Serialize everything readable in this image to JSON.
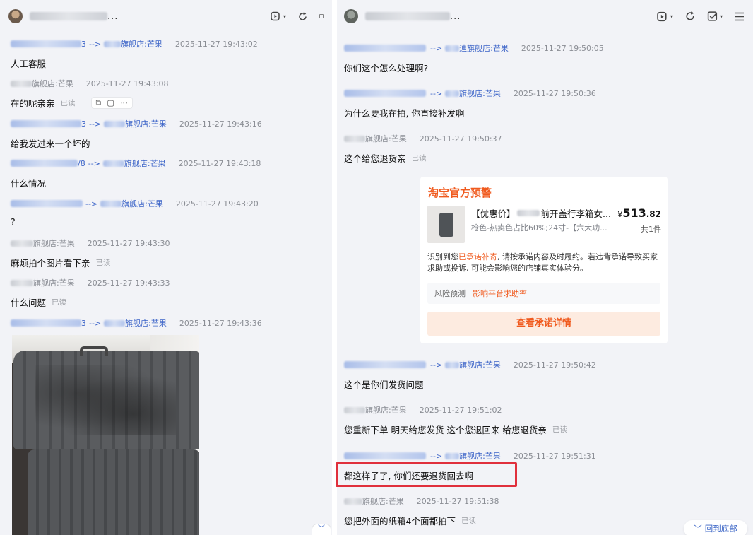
{
  "left_chat": {
    "title_suffix": "...",
    "messages": [
      {
        "from_num": "3",
        "arrow": "-->",
        "to": "旗舰店:芒果",
        "time": "2025-11-27 19:43:02",
        "text": "人工客服",
        "read": ""
      },
      {
        "from": "旗舰店:芒果",
        "time": "2025-11-27 19:43:08",
        "text": "在的呢亲亲",
        "read": "已读"
      },
      {
        "from_num": "3",
        "arrow": "-->",
        "to": "旗舰店:芒果",
        "time": "2025-11-27 19:43:16",
        "text": "给我发过来一个坏的",
        "read": ""
      },
      {
        "from_num": "/8",
        "arrow": "-->",
        "to": "旗舰店:芒果",
        "time": "2025-11-27 19:43:18",
        "text": "什么情况",
        "read": ""
      },
      {
        "from_num": "",
        "arrow": "-->",
        "to": "旗舰店:芒果",
        "time": "2025-11-27 19:43:20",
        "text": "?",
        "read": ""
      },
      {
        "from": "旗舰店:芒果",
        "time": "2025-11-27 19:43:30",
        "text": "麻烦拍个图片看下亲",
        "read": "已读"
      },
      {
        "from": "旗舰店:芒果",
        "time": "2025-11-27 19:43:33",
        "text": "什么问题",
        "read": "已读"
      },
      {
        "from_num": "3",
        "arrow": "-->",
        "to": "旗舰店:芒果",
        "time": "2025-11-27 19:43:36",
        "text": "",
        "read": ""
      }
    ],
    "collapse_label": "⌵"
  },
  "right_chat": {
    "title_suffix": "...",
    "messages": [
      {
        "arrow": "-->",
        "to": "迪旗舰店:芒果",
        "time": "2025-11-27 19:50:05",
        "text": "你们这个怎么处理啊?",
        "read": ""
      },
      {
        "arrow": "-->",
        "to": "旗舰店:芒果",
        "time": "2025-11-27 19:50:36",
        "text": "为什么要我在拍, 你直接补发啊",
        "read": ""
      },
      {
        "from": "旗舰店:芒果",
        "time": "2025-11-27 19:50:37",
        "text": "这个给您退货亲",
        "read": "已读"
      },
      {
        "arrow": "-->",
        "to": "旗舰店:芒果",
        "time": "2025-11-27 19:50:42",
        "text": "这个是你们发货问题",
        "read": ""
      },
      {
        "from": "旗舰店:芒果",
        "time": "2025-11-27 19:51:02",
        "text": "您重新下单 明天给您发货  这个您退回来 给您退货亲",
        "read": "已读"
      },
      {
        "arrow": "-->",
        "to": "旗舰店:芒果",
        "time": "2025-11-27 19:51:31",
        "text": "都这样子了, 你们还要退货回去啊",
        "read": ""
      },
      {
        "from": "旗舰店:芒果",
        "time": "2025-11-27 19:51:38",
        "text": "您把外面的纸箱4个面都拍下",
        "read": "已读"
      }
    ],
    "card": {
      "title": "淘宝官方预警",
      "product_prefix": "【优惠价】",
      "product_suffix": "前开盖行李箱女...",
      "currency": "¥",
      "price_int": "513",
      "price_dec": ".82",
      "sku": "枪色-热卖色占比60%;24寸-【六大功...",
      "count": "共1件",
      "text_before": "识别到您",
      "text_highlight": "已承诺补寄",
      "text_after": ", 请按承诺内容及时履约。若违背承诺导致买家求助或投诉, 可能会影响您的店铺真实体验分。",
      "risk_label": "风险预测",
      "risk_value": "影响平台求助率",
      "cta": "查看承诺详情"
    },
    "back_to_bottom": "回到底部"
  }
}
